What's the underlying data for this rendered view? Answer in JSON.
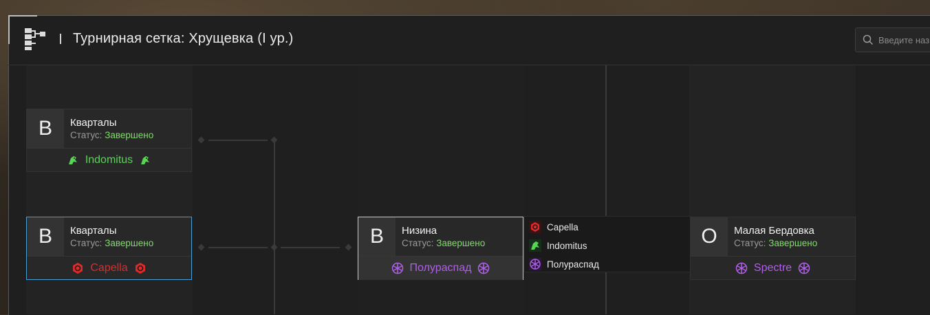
{
  "header": {
    "title": "Турнирная сетка: Хрущевка (I ур.)",
    "search_placeholder": "Введите название"
  },
  "matches": [
    {
      "letter": "В",
      "name": "Кварталы",
      "status_label": "Статус:",
      "status_value": "Завершено",
      "winner": "Indomitus",
      "winner_icon": "indomitus-icon"
    },
    {
      "letter": "В",
      "name": "Кварталы",
      "status_label": "Статус:",
      "status_value": "Завершено",
      "winner": "Capella",
      "winner_icon": "capella-icon"
    },
    {
      "letter": "В",
      "name": "Низина",
      "status_label": "Статус:",
      "status_value": "Завершено",
      "winner": "Полураспад",
      "winner_icon": "poluraspad-icon"
    },
    {
      "letter": "О",
      "name": "Малая Бердовка",
      "status_label": "Статус:",
      "status_value": "Завершено",
      "winner": "Spectre",
      "winner_icon": "spectre-icon"
    }
  ],
  "popup": {
    "items": [
      {
        "label": "Capella",
        "icon": "capella-icon"
      },
      {
        "label": "Indomitus",
        "icon": "indomitus-icon"
      },
      {
        "label": "Полураспад",
        "icon": "poluraspad-icon"
      }
    ]
  },
  "colors": {
    "status_done": "#7fdc6a",
    "indomitus": "#59d455",
    "capella": "#e02a2a",
    "poluraspad": "#b05fe8",
    "selection_border": "#4a9fd8"
  }
}
